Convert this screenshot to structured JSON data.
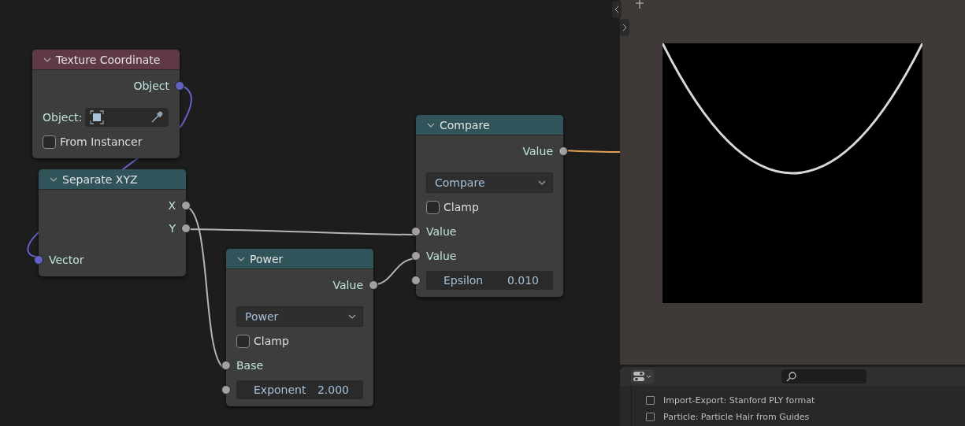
{
  "nodes": [
    {
      "title": "Texture Coordinate",
      "color": "#5f3a45",
      "rows": [
        {
          "kind": "output",
          "label": "Object",
          "color": "#6363c7"
        },
        {
          "kind": "object_field",
          "label": "Object:"
        },
        {
          "kind": "checkbox",
          "label": "From Instancer",
          "checked": false
        }
      ]
    },
    {
      "title": "Separate XYZ",
      "color": "#30545a",
      "rows": [
        {
          "kind": "output",
          "label": "X",
          "color": "#a1a1a1"
        },
        {
          "kind": "output",
          "label": "Y",
          "color": "#a1a1a1"
        },
        {
          "kind": "input",
          "label": "Vector",
          "color": "#6363c7"
        }
      ]
    },
    {
      "title": "Power",
      "color": "#30545a",
      "rows": [
        {
          "kind": "output",
          "label": "Value",
          "color": "#a1a1a1"
        },
        {
          "kind": "dropdown",
          "label": "Power"
        },
        {
          "kind": "checkbox",
          "label": "Clamp",
          "checked": false
        },
        {
          "kind": "input",
          "label": "Base",
          "color": "#a1a1a1"
        },
        {
          "kind": "field",
          "label": "Exponent",
          "value": "2.000",
          "color": "#a1a1a1"
        }
      ]
    },
    {
      "title": "Compare",
      "color": "#30545a",
      "rows": [
        {
          "kind": "output",
          "label": "Value",
          "color": "#a1a1a1"
        },
        {
          "kind": "dropdown",
          "label": "Compare"
        },
        {
          "kind": "checkbox",
          "label": "Clamp",
          "checked": false
        },
        {
          "kind": "input",
          "label": "Value",
          "color": "#a1a1a1"
        },
        {
          "kind": "input",
          "label": "Value",
          "color": "#a1a1a1"
        },
        {
          "kind": "field",
          "label": "Epsilon",
          "value": "0.010",
          "color": "#a1a1a1"
        }
      ]
    }
  ],
  "addons": [
    {
      "label": "Import-Export: Stanford PLY format",
      "checked": false
    },
    {
      "label": "Particle: Particle Hair from Guides",
      "checked": false
    }
  ]
}
